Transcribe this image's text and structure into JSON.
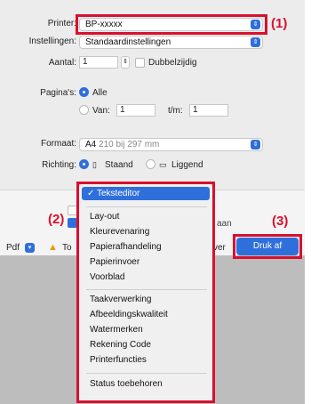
{
  "printer": {
    "label": "Printer:",
    "value": "BP-xxxxx"
  },
  "presets": {
    "label": "Instellingen:",
    "value": "Standaardinstellingen"
  },
  "copies": {
    "label": "Aantal:",
    "value": "1",
    "duplex_label": "Dubbelzijdig"
  },
  "pages": {
    "label": "Pagina's:",
    "all_label": "Alle",
    "from_label": "Van:",
    "from_value": "1",
    "to_label": "t/m:",
    "to_value": "1"
  },
  "paper": {
    "label": "Formaat:",
    "value": "A4",
    "detail": "210 bij 297 mm"
  },
  "orientation": {
    "label": "Richting:",
    "portrait": "Staand",
    "landscape": "Liggend"
  },
  "menu": {
    "selected": "✓ Teksteditor",
    "group1": [
      "Lay-out",
      "Kleurevenaring",
      "Papierafhandeling",
      "Papierinvoer",
      "Voorblad"
    ],
    "group2": [
      "Taakverwerking",
      "Afbeeldingskwaliteit",
      "Watermerken",
      "Rekening Code",
      "Printerfuncties"
    ],
    "group3": [
      "Status toebehoren"
    ]
  },
  "bottom": {
    "pdf_label": "Pdf",
    "warn_text": "To",
    "print_label": "Druk af",
    "partial_right": "aan",
    "partial_right2": "ver"
  },
  "callouts": [
    "(1)",
    "(2)",
    "(3)"
  ],
  "colors": {
    "accent": "#2f6fdb",
    "callout_red": "#d8102d"
  }
}
